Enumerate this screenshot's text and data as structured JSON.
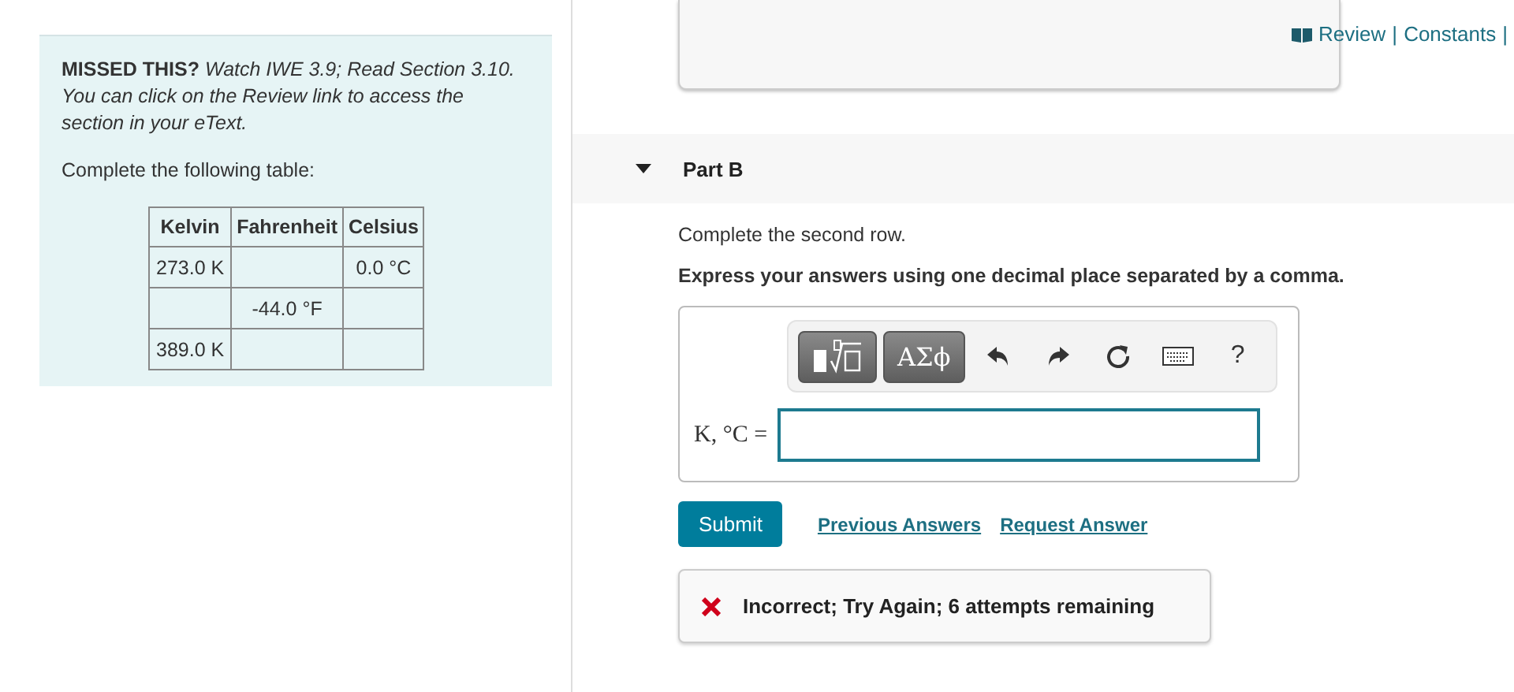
{
  "hint": {
    "label": "MISSED THIS?",
    "text": "Watch IWE 3.9; Read Section 3.10. You can click on the Review link to access the section in your eText."
  },
  "instruction": "Complete the following table:",
  "table": {
    "columns": [
      "Kelvin",
      "Fahrenheit",
      "Celsius"
    ],
    "rows": [
      [
        "273.0 K",
        "",
        "0.0 °C"
      ],
      [
        "",
        "-44.0 °F",
        ""
      ],
      [
        "389.0 K",
        "",
        ""
      ]
    ]
  },
  "top_links": [
    "Review",
    "Constants"
  ],
  "top_separators": [
    "|",
    "|"
  ],
  "part": {
    "title": "Part B",
    "expanded": true
  },
  "prompt": "Complete the second row.",
  "directive": "Express your answers using one decimal place separated by a comma.",
  "toolbar": {
    "symbols_button": "ΑΣϕ",
    "help": "?"
  },
  "answer": {
    "label": "K, °C ="
  },
  "buttons": {
    "submit": "Submit",
    "links": [
      "Previous Answers",
      "Request Answer"
    ]
  },
  "feedback": {
    "kind": "incorrect",
    "text": "Incorrect; Try Again; 6 attempts remaining"
  }
}
